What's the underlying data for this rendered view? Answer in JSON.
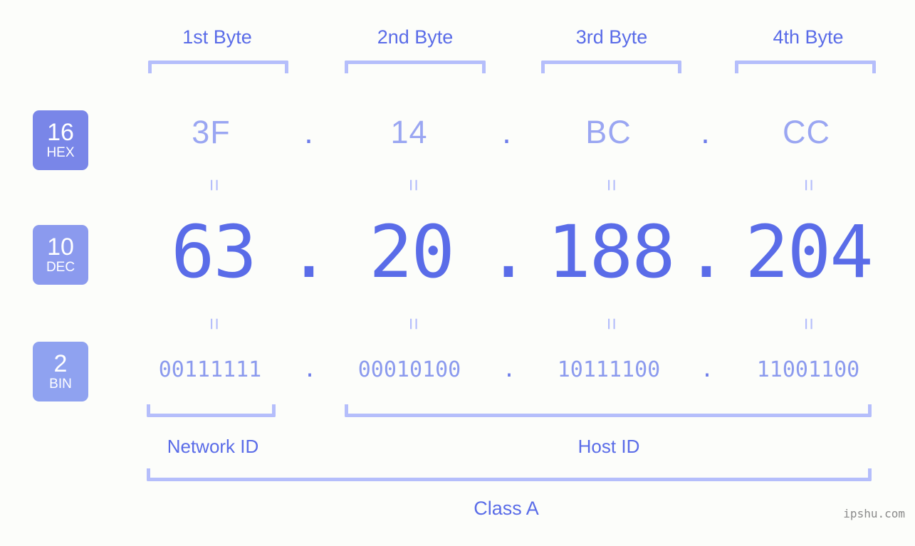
{
  "headers": [
    {
      "label": "1st Byte"
    },
    {
      "label": "2nd Byte"
    },
    {
      "label": "3rd Byte"
    },
    {
      "label": "4th Byte"
    }
  ],
  "radix_badges": [
    {
      "num": "16",
      "name": "HEX",
      "color": "#7986e8"
    },
    {
      "num": "10",
      "name": "DEC",
      "color": "#8b9aee"
    },
    {
      "num": "2",
      "name": "BIN",
      "color": "#8fa2f0"
    }
  ],
  "rows": {
    "hex": {
      "octets": [
        "3F",
        "14",
        "BC",
        "CC"
      ],
      "separator": "."
    },
    "dec": {
      "octets": [
        "63",
        "20",
        "188",
        "204"
      ],
      "separator": "."
    },
    "bin": {
      "octets": [
        "00111111",
        "00010100",
        "10111100",
        "11001100"
      ],
      "separator": "."
    }
  },
  "equals_symbol": "=",
  "segments": {
    "network_id": {
      "label": "Network ID"
    },
    "host_id": {
      "label": "Host ID"
    }
  },
  "class_label": "Class A",
  "watermark": "ipshu.com",
  "colors": {
    "background": "#fcfdfa",
    "bracket": "#b5befb",
    "label_blue": "#5a6ce8",
    "hex_value": "#9aa6f2",
    "dec_value": "#5a6ce8",
    "bin_value": "#8b9aee"
  }
}
